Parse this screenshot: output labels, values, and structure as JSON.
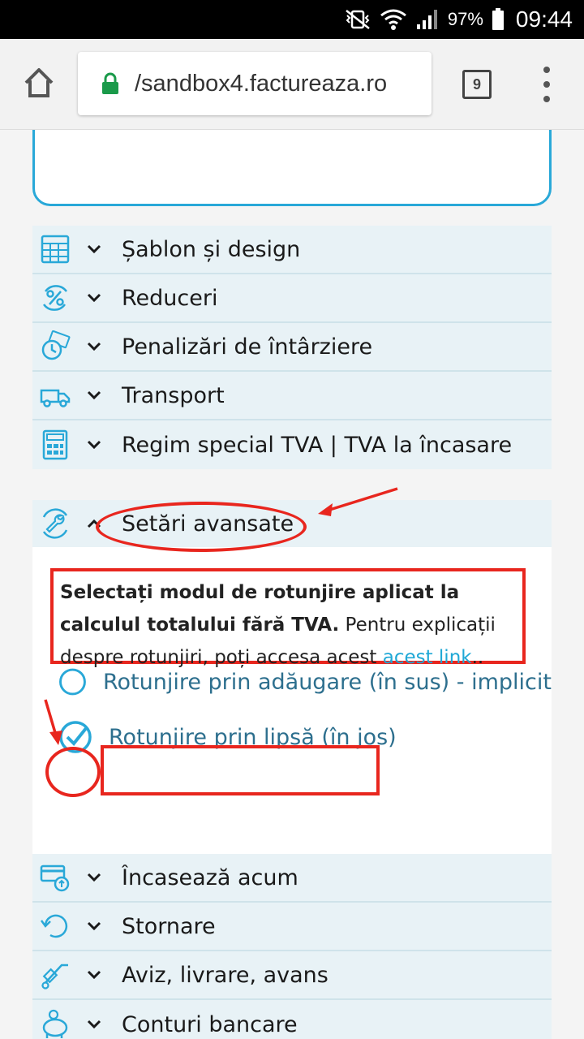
{
  "status_bar": {
    "battery": "97%",
    "time": "09:44"
  },
  "browser": {
    "url": "/sandbox4.factureaza.ro",
    "tab_count": "9"
  },
  "accordion_top": [
    {
      "label": "Șablon și design",
      "icon": "template-grid-icon"
    },
    {
      "label": "Reduceri",
      "icon": "percent-icon"
    },
    {
      "label": "Penalizări de întârziere",
      "icon": "clock-money-icon"
    },
    {
      "label": "Transport",
      "icon": "truck-icon"
    },
    {
      "label": "Regim special TVA | TVA la încasare",
      "icon": "calculator-icon"
    }
  ],
  "advanced": {
    "title": "Setări avansate",
    "icon": "wrench-icon",
    "desc_bold": "Selectați modul de rotunjire aplicat la calculul totalului fără TVA.",
    "desc_text": " Pentru explicații despre rotunjiri, poți accesa acest ",
    "desc_link": "acest link",
    "desc_end": "..",
    "option_up": "Rotunjire prin adăugare (în sus) - implicit",
    "option_down": "Rotunjire prin lipsă (în jos)",
    "selected": "option_down"
  },
  "accordion_bottom": [
    {
      "label": "Încasează acum",
      "icon": "payment-card-icon"
    },
    {
      "label": "Stornare",
      "icon": "reverse-icon"
    },
    {
      "label": "Aviz, livrare, avans",
      "icon": "hand-truck-icon"
    },
    {
      "label": "Conturi bancare",
      "icon": "piggy-bank-icon"
    }
  ],
  "colors": {
    "accent": "#29a8d8",
    "annotation": "#e8261e",
    "row_bg": "#e8f2f6"
  }
}
